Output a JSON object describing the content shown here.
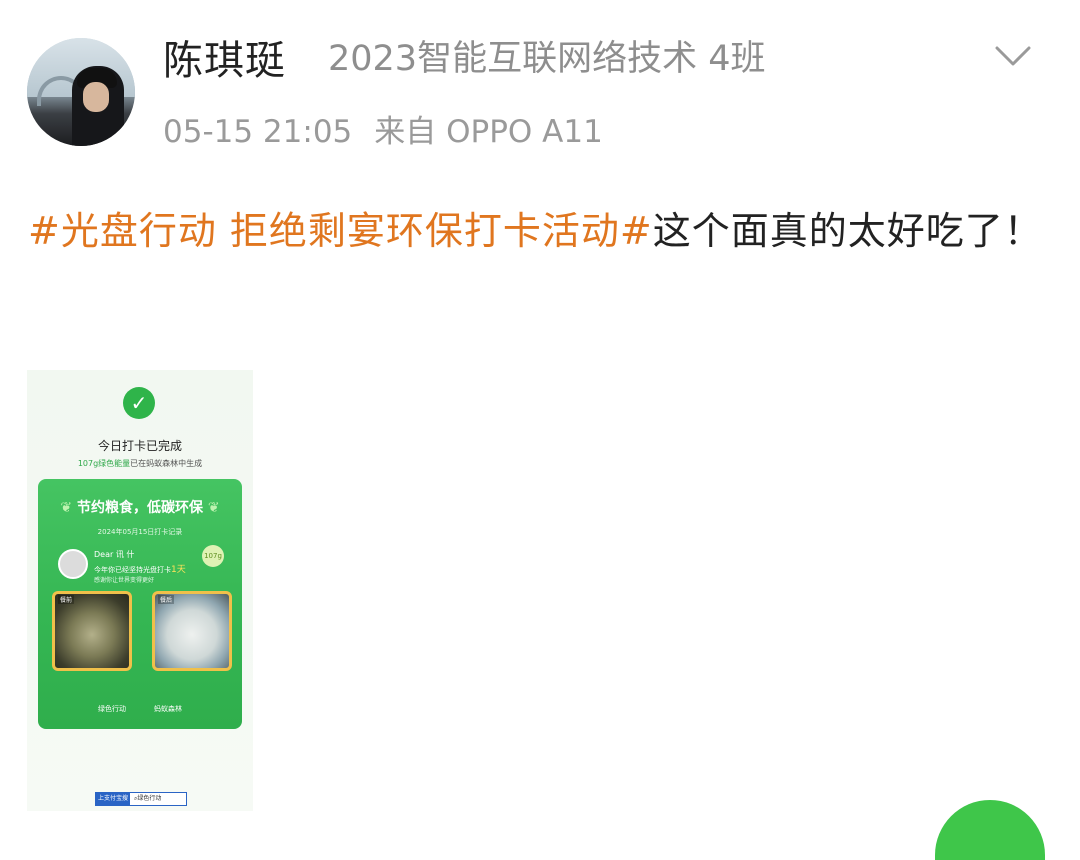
{
  "post": {
    "username": "陈琪珽",
    "group": "2023智能互联网络技术 4班",
    "time": "05-15 21:05",
    "source": "来自 OPPO A11",
    "topic": "#光盘行动 拒绝剩宴环保打卡活动#",
    "text": "这个面真的太好吃了！"
  },
  "thumbnail": {
    "done_title": "今日打卡已完成",
    "done_energy": "107g绿色能量",
    "done_rest": "已在蚂蚁森林中生成",
    "card_title": "节约粮食，低碳环保",
    "card_date": "2024年05月15日打卡记录",
    "dear": "Dear 讯 什",
    "streak_prefix": "今年你已经坚持光盘打卡",
    "streak_days": "1天",
    "thanks": "感谢你让世界变得更好",
    "badge": "107g",
    "before_label": "餐前",
    "after_label": "餐后",
    "foot_left": "绿色行动",
    "foot_right": "蚂蚁森林",
    "search_brand": "上支付宝搜",
    "search_text": "绿色行动"
  },
  "colors": {
    "topic": "#e0761f",
    "card_green": "#35b653",
    "meta_grey": "#9a9a9a"
  },
  "icons": [
    "chevron-down-icon",
    "check-icon",
    "search-icon"
  ]
}
